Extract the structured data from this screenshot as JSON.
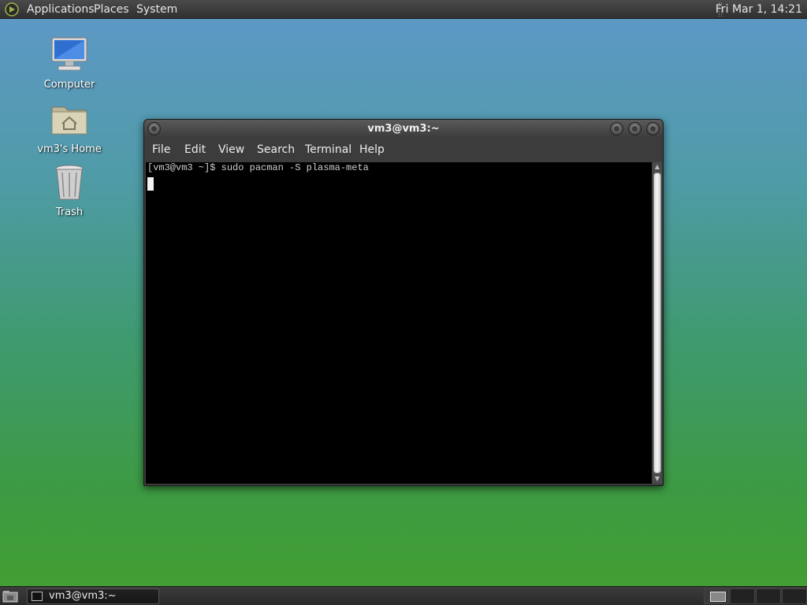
{
  "top_panel": {
    "menus": [
      "Applications",
      "Places",
      "System"
    ],
    "clock": "Fri Mar  1, 14:21"
  },
  "desktop": {
    "icons": [
      {
        "label": "Computer",
        "icon": "computer-icon"
      },
      {
        "label": "vm3's Home",
        "icon": "home-folder-icon"
      },
      {
        "label": "Trash",
        "icon": "trash-icon"
      }
    ]
  },
  "window": {
    "title": "vm3@vm3:~",
    "menu": [
      "File",
      "Edit",
      "View",
      "Search",
      "Terminal",
      "Help"
    ],
    "terminal": {
      "lines": [
        "[vm3@vm3 ~]$ sudo pacman -S plasma-meta"
      ]
    }
  },
  "bottom_panel": {
    "tasks": [
      {
        "label": "vm3@vm3:~"
      }
    ],
    "workspaces": 4
  },
  "colors": {
    "panel": "#333333",
    "terminal_bg": "#000000",
    "terminal_fg": "#cfcfcf",
    "desktop_top": "#5f98c9",
    "desktop_bottom": "#43a02f"
  }
}
